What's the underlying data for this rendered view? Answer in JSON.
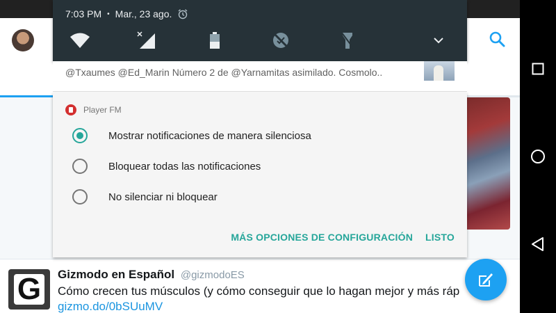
{
  "status_bar": {
    "time": "7:03 PM",
    "separator": "•",
    "date": "Mar., 23 ago."
  },
  "quick_settings": {
    "icons": [
      "wifi-icon",
      "signal-icon",
      "battery-icon",
      "data-saver-icon",
      "flashlight-icon",
      "expand-chevron-icon"
    ]
  },
  "previous_notification": {
    "text": "@Txaumes @Ed_Marin Número 2 de @Yarnamitas asimilado. Cosmolo.."
  },
  "notification_card": {
    "app_name": "Player FM",
    "options": [
      {
        "label": "Mostrar notificaciones de manera silenciosa",
        "selected": true
      },
      {
        "label": "Bloquear todas las notificaciones",
        "selected": false
      },
      {
        "label": "No silenciar ni bloquear",
        "selected": false
      }
    ],
    "more_settings_label": "MÁS OPCIONES DE CONFIGURACIÓN",
    "done_label": "LISTO",
    "accent_color": "#26a69a"
  },
  "background_app": {
    "tweet": {
      "author": "Gizmodo en Español",
      "handle": "@gizmodoES",
      "avatar_letter": "G",
      "text": "Cómo crecen tus músculos (y cómo conseguir que lo hagan mejor y más ráp",
      "link": "gizmo.do/0bSUuMV"
    },
    "brand_color": "#1da1f2"
  },
  "nav_bar": {
    "buttons": [
      "recents-square-icon",
      "home-circle-icon",
      "back-triangle-icon"
    ]
  }
}
